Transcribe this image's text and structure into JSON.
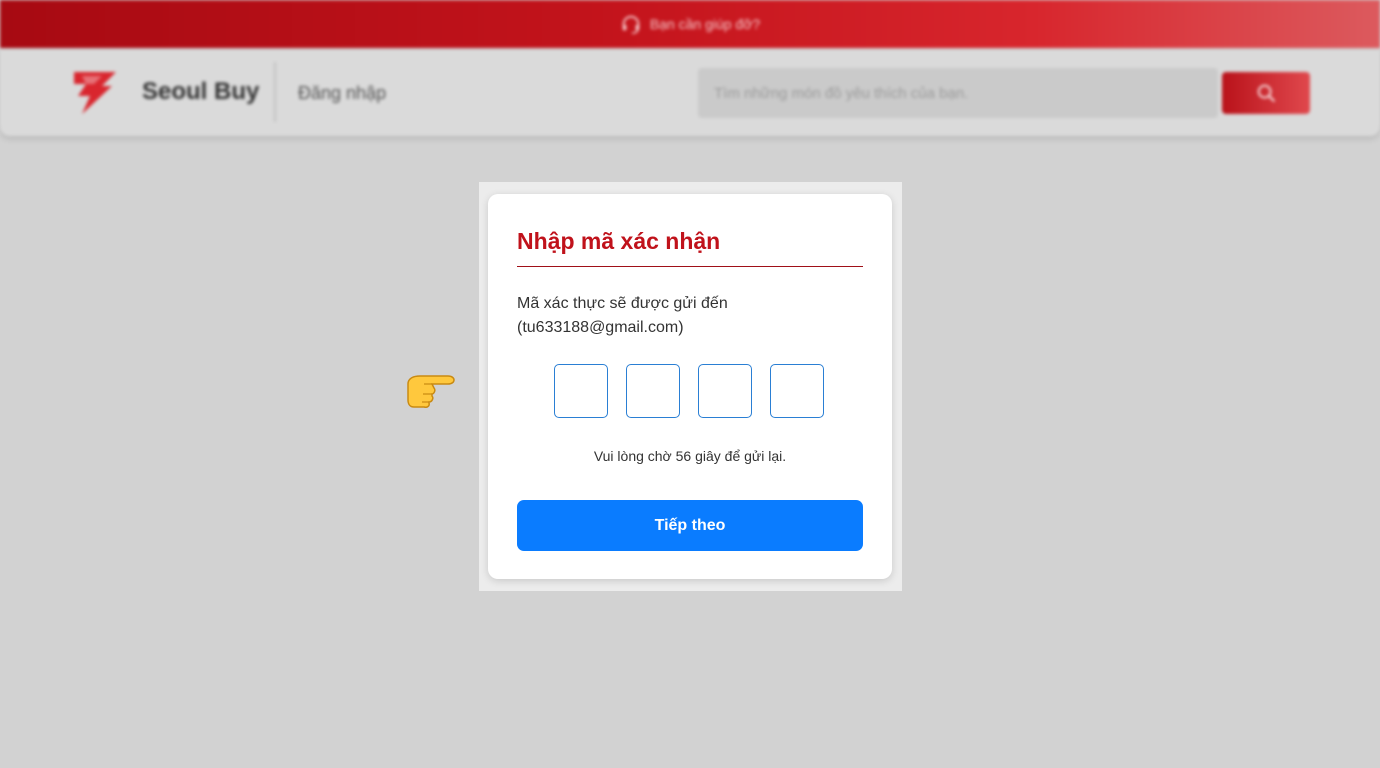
{
  "topbar": {
    "help_text": "Bạn cần giúp đỡ?",
    "icon": "headset-icon"
  },
  "header": {
    "brand": "Seoul Buy",
    "login": "Đăng nhập",
    "search_placeholder": "Tìm những món đồ yêu thích của bạn.",
    "search_icon": "search-icon"
  },
  "modal": {
    "title": "Nhập mã xác nhận",
    "desc_line1": "Mã xác thực sẽ được gửi đến",
    "desc_line2": "(tu633188@gmail.com)",
    "otp_values": [
      "",
      "",
      "",
      ""
    ],
    "resend_text": "Vui lòng chờ 56 giây để gửi lại.",
    "next_button": "Tiếp theo"
  },
  "colors": {
    "brand_red": "#c0121b",
    "primary_blue": "#0a7cff",
    "otp_border": "#2a7fd4"
  },
  "pointer_icon": "pointing-hand-icon"
}
